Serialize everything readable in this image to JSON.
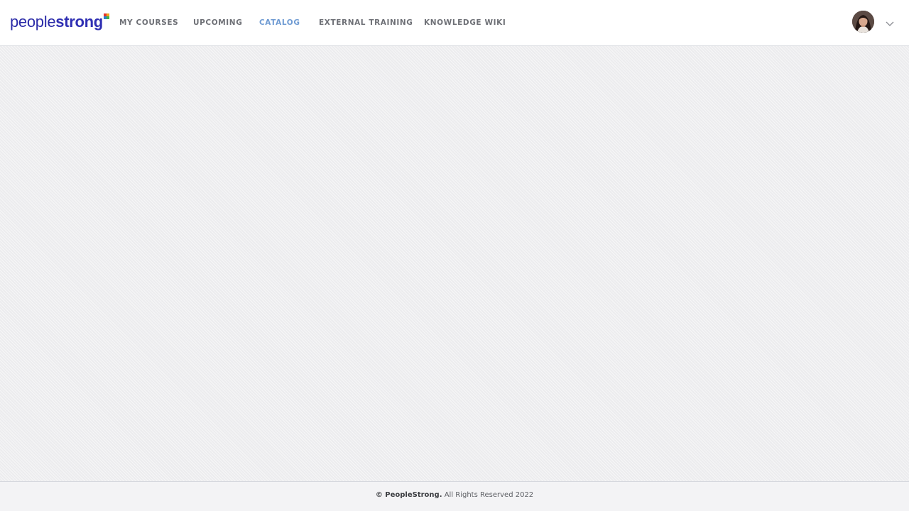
{
  "brand": {
    "logo_part1": "people",
    "logo_part2": "strong",
    "mark_colors": [
      "#f2a41b",
      "#e3342f",
      "#3ab54a",
      "#2d7fd0"
    ]
  },
  "nav": {
    "items": [
      {
        "label": "MY COURSES",
        "active": false
      },
      {
        "label": "UPCOMING",
        "active": false
      },
      {
        "label": "CATALOG",
        "active": true
      },
      {
        "label": "EXTERNAL TRAINING",
        "active": false
      },
      {
        "label": "KNOWLEDGE WIKI",
        "active": false
      }
    ]
  },
  "user_menu": {
    "avatar_icon": "user-avatar",
    "dropdown_icon": "chevron-down-icon"
  },
  "footer": {
    "copyright_brand": "© PeopleStrong.",
    "copyright_rest": " All Rights Reserved 2022"
  },
  "colors": {
    "accent": "#6f9bd3",
    "brand": "#2b2ba8",
    "nav_text": "#6e7076",
    "content_bg": "#ececee"
  }
}
